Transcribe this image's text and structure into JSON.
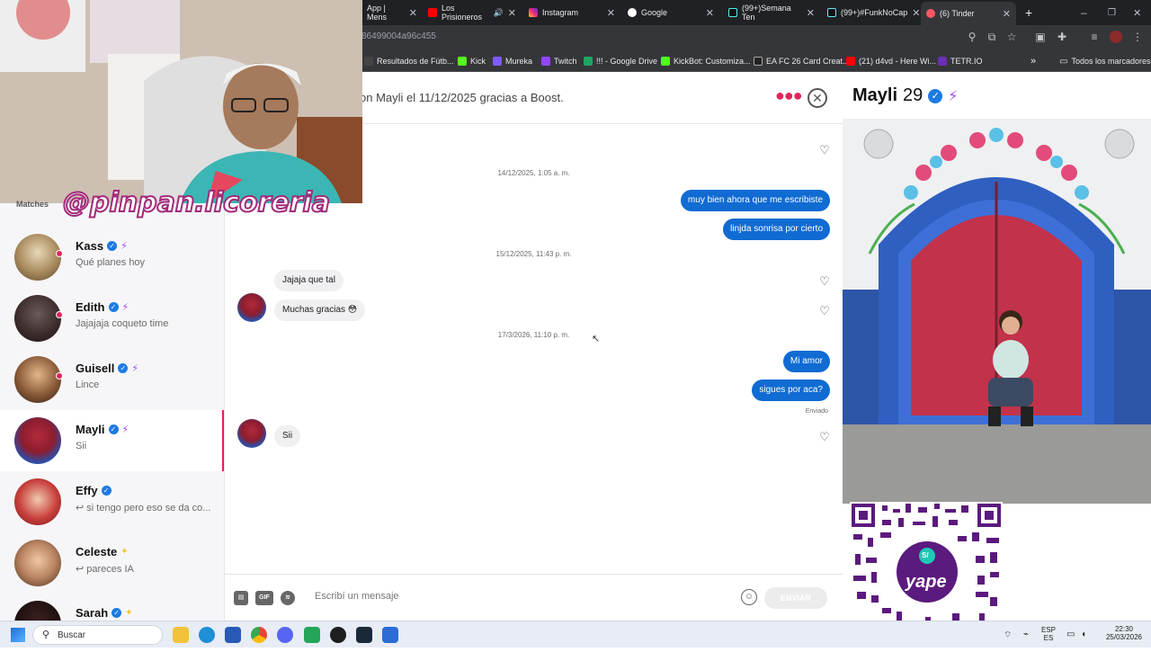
{
  "browser": {
    "tabs": [
      {
        "label": "App | Mens",
        "icon": "whatsapp-icon"
      },
      {
        "label": "Los Prisioneros",
        "icon": "youtube-icon"
      },
      {
        "label": "Instagram",
        "icon": "instagram-icon"
      },
      {
        "label": "Google",
        "icon": "google-icon"
      },
      {
        "label": "(99+)Semana Ten",
        "icon": "tiktok-icon"
      },
      {
        "label": "(99+)#FunkNoCap",
        "icon": "tiktok-icon"
      },
      {
        "label": "(6) Tinder",
        "icon": "tinder-icon"
      }
    ],
    "new_tab": "+",
    "url": "86499004a96c455",
    "bookmarks": [
      "Resultados de Fútb...",
      "Kick",
      "Mureka",
      "Twitch",
      "!!! - Google Drive",
      "KickBot: Customiza...",
      "EA FC 26 Card Creat...",
      "(21) d4vd - Here Wi...",
      "TETR.IO"
    ],
    "bookmarks_more": "»",
    "all_bookmarks": "Todos los marcadores"
  },
  "overlay": {
    "handle": "@pinpan.licoreria"
  },
  "sidebar": {
    "section_label": "Matches",
    "conversations": [
      {
        "name": "Kass",
        "snippet": "Qué planes hoy",
        "verified": true,
        "badge": "bolt",
        "unread": true
      },
      {
        "name": "Edith",
        "snippet": "Jajajaja coqueto time",
        "verified": true,
        "badge": "bolt",
        "unread": true
      },
      {
        "name": "Guisell",
        "snippet": "Lince",
        "verified": true,
        "badge": "bolt",
        "unread": true
      },
      {
        "name": "Mayli",
        "snippet": "Sii",
        "verified": true,
        "badge": "bolt",
        "unread": false,
        "selected": true
      },
      {
        "name": "Effy",
        "snippet": "↩ si tengo pero eso se da co...",
        "verified": true,
        "badge": "",
        "unread": false
      },
      {
        "name": "Celeste",
        "snippet": "↩ pareces IA",
        "verified": false,
        "badge": "star",
        "unread": false
      },
      {
        "name": "Sarah",
        "snippet": "",
        "verified": true,
        "badge": "star",
        "unread": false
      }
    ]
  },
  "chat": {
    "header_text": "on Mayli el 11/12/2025 gracias a Boost.",
    "messages": [
      {
        "timestamp": "14/12/2025, 1:05 a. m."
      },
      {
        "out": "muy bien ahora que me escribiste"
      },
      {
        "out": "linjda sonrisa por cierto"
      },
      {
        "timestamp": "15/12/2025, 11:43 p. m."
      },
      {
        "in": "Jajaja que tal"
      },
      {
        "in": "Muchas gracias 😳"
      },
      {
        "timestamp": "17/3/2026, 11:10 p. m."
      },
      {
        "out": "Mi amor"
      },
      {
        "out": "sigues por aca?"
      },
      {
        "status": "Enviado"
      },
      {
        "in": "Sii"
      }
    ],
    "composer": {
      "gif_label": "GIF",
      "placeholder": "Escribí un mensaje",
      "send_label": "ENVIAR"
    }
  },
  "profile": {
    "name": "Mayli",
    "age": "29",
    "verified": true,
    "badge": "bolt"
  },
  "qr": {
    "brand": "yape",
    "symbol": "S/"
  },
  "taskbar": {
    "search_label": "Buscar",
    "language": "ESP",
    "region": "ES",
    "time": "22:30",
    "date": "25/03/2026"
  },
  "colors": {
    "tinder_accent": "#e0245e",
    "bubble_out": "#106bd3",
    "bubble_in": "#f0f0f2",
    "boost_purple": "#a445f0",
    "verified_blue": "#1d7ae2",
    "yape_purple": "#5b1a7e"
  }
}
